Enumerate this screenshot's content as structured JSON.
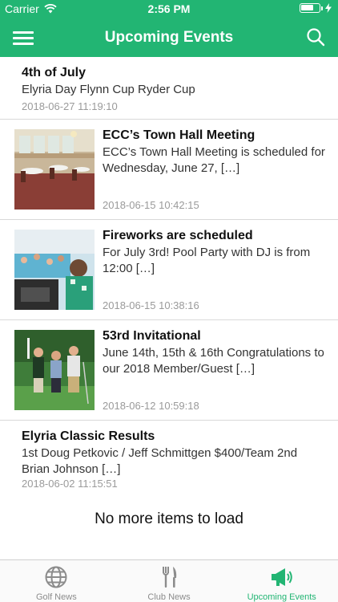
{
  "status_bar": {
    "carrier": "Carrier",
    "time": "2:56 PM",
    "battery_level": 0.7
  },
  "header": {
    "title": "Upcoming Events",
    "menu_icon": "hamburger-menu-icon",
    "search_icon": "search-icon"
  },
  "events": [
    {
      "title": "4th of July",
      "excerpt": "Elyria Day Flynn Cup Ryder Cup",
      "date": "2018-06-27 11:19:10"
    },
    {
      "title": "ECC’s Town Hall Meeting",
      "excerpt": "ECC’s Town Hall Meeting is scheduled for Wednesday, June 27, […]",
      "date": "2018-06-15 10:42:15"
    },
    {
      "title": "Fireworks are scheduled",
      "excerpt": "For July 3rd! Pool Party with DJ is from 12:00 […]",
      "date": "2018-06-15 10:38:16"
    },
    {
      "title": "53rd Invitational",
      "excerpt": "June 14th, 15th & 16th Congratulations to our 2018 Member/Guest […]",
      "date": "2018-06-12 10:59:18"
    },
    {
      "title": "Elyria Classic Results",
      "excerpt": "1st Doug Petkovic / Jeff Schmittgen $400/Team 2nd Brian Johnson […]",
      "date": "2018-06-02 11:15:51"
    }
  ],
  "list_footer": "No more items to load",
  "tabs": [
    {
      "label": "Golf News",
      "icon": "globe-icon",
      "active": false
    },
    {
      "label": "Club News",
      "icon": "fork-knife-icon",
      "active": false
    },
    {
      "label": "Upcoming Events",
      "icon": "megaphone-icon",
      "active": true
    }
  ],
  "colors": {
    "brand_green": "#22b573",
    "inactive_tab": "#8c8c8c",
    "date_gray": "#9a9a9a"
  }
}
